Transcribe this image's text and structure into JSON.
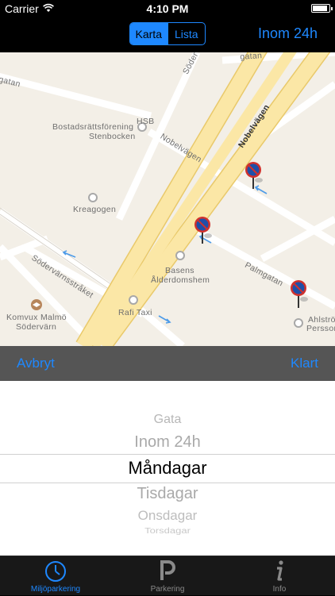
{
  "status_bar": {
    "carrier": "Carrier",
    "time": "4:10 PM",
    "battery_level": 0.9
  },
  "nav": {
    "segments": [
      {
        "label": "Karta",
        "selected": true
      },
      {
        "label": "Lista",
        "selected": false
      }
    ],
    "right_button": "Inom 24h"
  },
  "map": {
    "labels": {
      "hsb": "HSB",
      "bostadsratt": "Bostadsrättsförening",
      "stenbocken": "Stenbocken",
      "kreagogen": "Kreagogen",
      "nobelvagen_main": "Nobelvägen",
      "nobelvagen_side": "Nobelvägen",
      "sodervarn": "Södervärnsstråket",
      "basens": "Basens",
      "alderdomshem": "Ålderdomshem",
      "komvux1": "Komvux Malmö",
      "komvux2": "Södervärn",
      "rafi": "Rafi Taxi",
      "palmgatan": "Palmgatan",
      "ahlstrom": "Ahlströ",
      "persson": "Persson",
      "soder_top": "Söder",
      "gatan_top_left": "gatan",
      "gatan_top_right": "gatan"
    },
    "pin_count": 3
  },
  "toolbar": {
    "cancel": "Avbryt",
    "done": "Klart"
  },
  "picker": {
    "options": [
      "Gata",
      "Inom 24h",
      "Måndagar",
      "Tisdagar",
      "Onsdagar",
      "Torsdagar"
    ],
    "selected": "Måndagar"
  },
  "tabs": [
    {
      "label": "Miljöparkering",
      "icon": "clock-icon",
      "active": true
    },
    {
      "label": "Parkering",
      "icon": "parking-icon",
      "active": false
    },
    {
      "label": "Info",
      "icon": "info-icon",
      "active": false
    }
  ],
  "colors": {
    "accent": "#1e88ff",
    "sign_red": "#d0312d",
    "sign_blue": "#1f4fa8",
    "road_yellow": "#fbe7a6"
  }
}
